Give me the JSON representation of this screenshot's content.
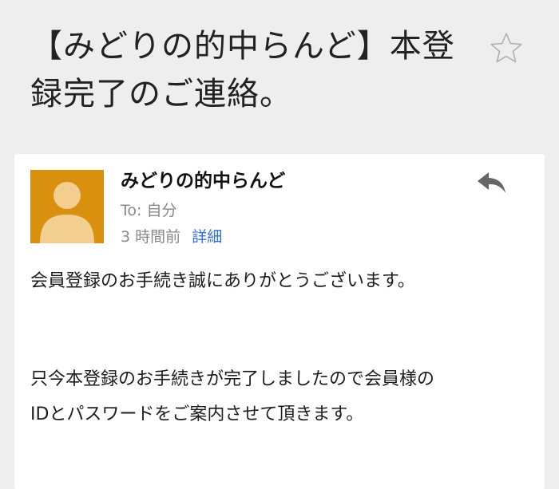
{
  "email": {
    "subject": "【みどりの的中らんど】本登録完了のご連絡。",
    "sender": "みどりの的中らんど",
    "to_label": "To:",
    "to_value": "自分",
    "time_ago": "3 時間前",
    "details_label": "詳細",
    "body": [
      "会員登録のお手続き誠にありがとうございます。",
      "只今本登録のお手続きが完了しましたので会員様の",
      "IDとパスワードをご案内させて頂きます。"
    ]
  },
  "icons": {
    "star": "star-outline-icon",
    "reply": "reply-arrow-icon",
    "avatar": "person-silhouette-icon"
  },
  "colors": {
    "background": "#eeeeee",
    "card": "#ffffff",
    "avatar_bg": "#d9900e",
    "avatar_figure": "#f2cf8f",
    "link": "#2f6fd6",
    "muted": "#888888",
    "icon": "#666666"
  }
}
